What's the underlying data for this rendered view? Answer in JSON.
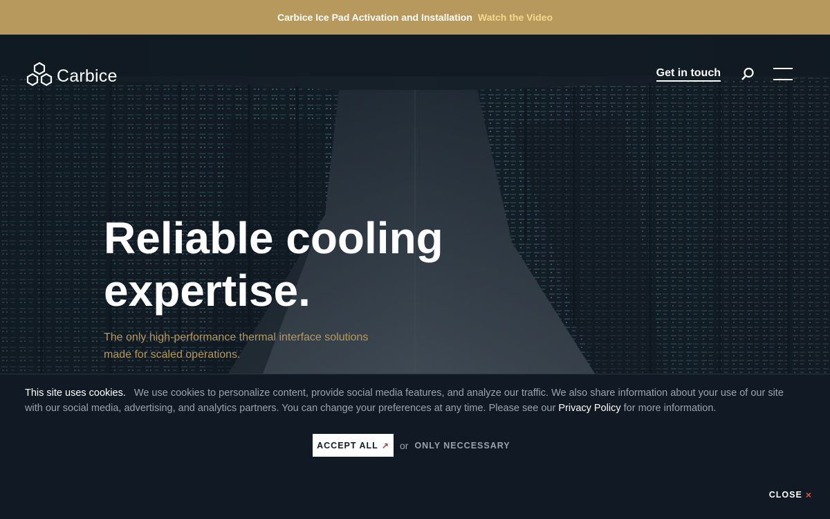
{
  "announcement": {
    "text": "Carbice Ice Pad Activation and Installation",
    "link": "Watch the Video"
  },
  "header": {
    "logo_text": "Carbice",
    "logo_icon": "hexagon-cluster-logo",
    "get_in_touch": "Get in touch",
    "search_icon": "search-icon",
    "menu_icon": "hamburger-menu-icon"
  },
  "hero": {
    "headline_line1": "Reliable cooling",
    "headline_line2": "expertise.",
    "subtext_line1": "The only high-performance thermal interface solutions",
    "subtext_line2": "made for scaled operations.",
    "background": "data-center-server-aisle"
  },
  "cookie_banner": {
    "lead": "This site uses cookies.",
    "body": "We use cookies to personalize content, provide social media features, and analyze our traffic. We also share information about your use of our site with our social media, advertising, and analytics partners. You can change your preferences at any time. Please see our",
    "policy_link": "Privacy Policy",
    "tail": "for more information.",
    "accept_all": "ACCEPT ALL",
    "accept_icon": "arrow-up-right-icon",
    "or": "or",
    "only_necessary": "ONLY NECCESSARY",
    "close": "CLOSE",
    "close_icon": "close-x-icon"
  },
  "colors": {
    "brand_gold": "#b7995e",
    "watch_link": "#f3d98c",
    "dark_background": "#111a24",
    "accent_red": "#e0573c"
  }
}
